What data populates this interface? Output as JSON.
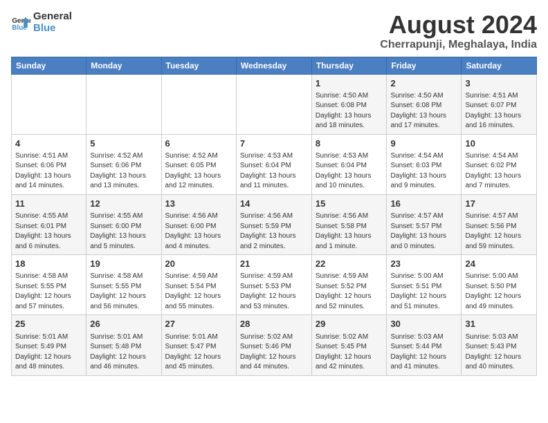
{
  "logo": {
    "line1": "General",
    "line2": "Blue"
  },
  "title": "August 2024",
  "subtitle": "Cherrapunji, Meghalaya, India",
  "weekdays": [
    "Sunday",
    "Monday",
    "Tuesday",
    "Wednesday",
    "Thursday",
    "Friday",
    "Saturday"
  ],
  "weeks": [
    [
      {
        "day": "",
        "info": ""
      },
      {
        "day": "",
        "info": ""
      },
      {
        "day": "",
        "info": ""
      },
      {
        "day": "",
        "info": ""
      },
      {
        "day": "1",
        "info": "Sunrise: 4:50 AM\nSunset: 6:08 PM\nDaylight: 13 hours and 18 minutes."
      },
      {
        "day": "2",
        "info": "Sunrise: 4:50 AM\nSunset: 6:08 PM\nDaylight: 13 hours and 17 minutes."
      },
      {
        "day": "3",
        "info": "Sunrise: 4:51 AM\nSunset: 6:07 PM\nDaylight: 13 hours and 16 minutes."
      }
    ],
    [
      {
        "day": "4",
        "info": "Sunrise: 4:51 AM\nSunset: 6:06 PM\nDaylight: 13 hours and 14 minutes."
      },
      {
        "day": "5",
        "info": "Sunrise: 4:52 AM\nSunset: 6:06 PM\nDaylight: 13 hours and 13 minutes."
      },
      {
        "day": "6",
        "info": "Sunrise: 4:52 AM\nSunset: 6:05 PM\nDaylight: 13 hours and 12 minutes."
      },
      {
        "day": "7",
        "info": "Sunrise: 4:53 AM\nSunset: 6:04 PM\nDaylight: 13 hours and 11 minutes."
      },
      {
        "day": "8",
        "info": "Sunrise: 4:53 AM\nSunset: 6:04 PM\nDaylight: 13 hours and 10 minutes."
      },
      {
        "day": "9",
        "info": "Sunrise: 4:54 AM\nSunset: 6:03 PM\nDaylight: 13 hours and 9 minutes."
      },
      {
        "day": "10",
        "info": "Sunrise: 4:54 AM\nSunset: 6:02 PM\nDaylight: 13 hours and 7 minutes."
      }
    ],
    [
      {
        "day": "11",
        "info": "Sunrise: 4:55 AM\nSunset: 6:01 PM\nDaylight: 13 hours and 6 minutes."
      },
      {
        "day": "12",
        "info": "Sunrise: 4:55 AM\nSunset: 6:00 PM\nDaylight: 13 hours and 5 minutes."
      },
      {
        "day": "13",
        "info": "Sunrise: 4:56 AM\nSunset: 6:00 PM\nDaylight: 13 hours and 4 minutes."
      },
      {
        "day": "14",
        "info": "Sunrise: 4:56 AM\nSunset: 5:59 PM\nDaylight: 13 hours and 2 minutes."
      },
      {
        "day": "15",
        "info": "Sunrise: 4:56 AM\nSunset: 5:58 PM\nDaylight: 13 hours and 1 minute."
      },
      {
        "day": "16",
        "info": "Sunrise: 4:57 AM\nSunset: 5:57 PM\nDaylight: 13 hours and 0 minutes."
      },
      {
        "day": "17",
        "info": "Sunrise: 4:57 AM\nSunset: 5:56 PM\nDaylight: 12 hours and 59 minutes."
      }
    ],
    [
      {
        "day": "18",
        "info": "Sunrise: 4:58 AM\nSunset: 5:55 PM\nDaylight: 12 hours and 57 minutes."
      },
      {
        "day": "19",
        "info": "Sunrise: 4:58 AM\nSunset: 5:55 PM\nDaylight: 12 hours and 56 minutes."
      },
      {
        "day": "20",
        "info": "Sunrise: 4:59 AM\nSunset: 5:54 PM\nDaylight: 12 hours and 55 minutes."
      },
      {
        "day": "21",
        "info": "Sunrise: 4:59 AM\nSunset: 5:53 PM\nDaylight: 12 hours and 53 minutes."
      },
      {
        "day": "22",
        "info": "Sunrise: 4:59 AM\nSunset: 5:52 PM\nDaylight: 12 hours and 52 minutes."
      },
      {
        "day": "23",
        "info": "Sunrise: 5:00 AM\nSunset: 5:51 PM\nDaylight: 12 hours and 51 minutes."
      },
      {
        "day": "24",
        "info": "Sunrise: 5:00 AM\nSunset: 5:50 PM\nDaylight: 12 hours and 49 minutes."
      }
    ],
    [
      {
        "day": "25",
        "info": "Sunrise: 5:01 AM\nSunset: 5:49 PM\nDaylight: 12 hours and 48 minutes."
      },
      {
        "day": "26",
        "info": "Sunrise: 5:01 AM\nSunset: 5:48 PM\nDaylight: 12 hours and 46 minutes."
      },
      {
        "day": "27",
        "info": "Sunrise: 5:01 AM\nSunset: 5:47 PM\nDaylight: 12 hours and 45 minutes."
      },
      {
        "day": "28",
        "info": "Sunrise: 5:02 AM\nSunset: 5:46 PM\nDaylight: 12 hours and 44 minutes."
      },
      {
        "day": "29",
        "info": "Sunrise: 5:02 AM\nSunset: 5:45 PM\nDaylight: 12 hours and 42 minutes."
      },
      {
        "day": "30",
        "info": "Sunrise: 5:03 AM\nSunset: 5:44 PM\nDaylight: 12 hours and 41 minutes."
      },
      {
        "day": "31",
        "info": "Sunrise: 5:03 AM\nSunset: 5:43 PM\nDaylight: 12 hours and 40 minutes."
      }
    ]
  ]
}
